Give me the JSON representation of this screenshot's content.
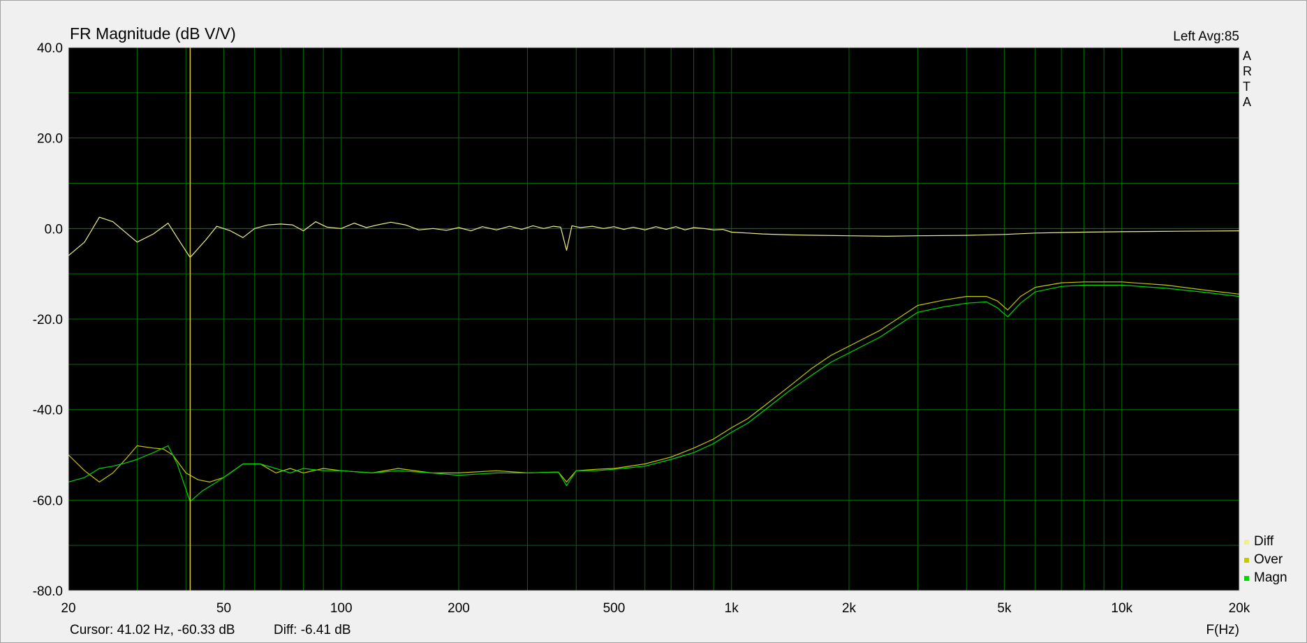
{
  "chart_data": {
    "type": "line",
    "title": "FR Magnitude (dB V/V)",
    "channel_info": "Left  Avg:85",
    "brand": [
      "A",
      "R",
      "T",
      "A"
    ],
    "xlabel": "F(Hz)",
    "xscale": "log",
    "xlim": [
      20,
      20000
    ],
    "ylim": [
      -80,
      40
    ],
    "x_ticks": [
      {
        "value": 20,
        "label": "20"
      },
      {
        "value": 50,
        "label": "50"
      },
      {
        "value": 100,
        "label": "100"
      },
      {
        "value": 200,
        "label": "200"
      },
      {
        "value": 500,
        "label": "500"
      },
      {
        "value": 1000,
        "label": "1k"
      },
      {
        "value": 2000,
        "label": "2k"
      },
      {
        "value": 5000,
        "label": "5k"
      },
      {
        "value": 10000,
        "label": "10k"
      },
      {
        "value": 20000,
        "label": "20k"
      }
    ],
    "y_ticks": [
      {
        "value": 40,
        "label": "40.0"
      },
      {
        "value": 20,
        "label": "20.0"
      },
      {
        "value": 0,
        "label": "0.0"
      },
      {
        "value": -20,
        "label": "-20.0"
      },
      {
        "value": -40,
        "label": "-40.0"
      },
      {
        "value": -60,
        "label": "-60.0"
      },
      {
        "value": -80,
        "label": "-80.0"
      }
    ],
    "grid": true,
    "legend_position": "bottom-right",
    "cursor": {
      "frequency": 41.02,
      "text": "Cursor: 41.02 Hz, -60.33 dB",
      "diff_text": "Diff: -6.41 dB",
      "color": "#d8c832"
    },
    "colors": {
      "background": "#000000",
      "frame": "#d0d0d0",
      "grid": "#006a00",
      "grid_zero": "#008a00"
    },
    "series": [
      {
        "name": "Diff",
        "color": "#f0f090",
        "points": [
          [
            20,
            -6
          ],
          [
            22,
            -3
          ],
          [
            24,
            2.5
          ],
          [
            26,
            1.5
          ],
          [
            30,
            -3
          ],
          [
            33,
            -1.2
          ],
          [
            36,
            1.2
          ],
          [
            38,
            -2
          ],
          [
            41,
            -6.4
          ],
          [
            45,
            -2.5
          ],
          [
            48,
            0.5
          ],
          [
            52,
            -0.5
          ],
          [
            56,
            -2
          ],
          [
            60,
            0
          ],
          [
            65,
            0.8
          ],
          [
            70,
            1
          ],
          [
            75,
            0.8
          ],
          [
            80,
            -0.5
          ],
          [
            86,
            1.5
          ],
          [
            92,
            0.3
          ],
          [
            100,
            0
          ],
          [
            108,
            1.2
          ],
          [
            116,
            0.2
          ],
          [
            124,
            0.8
          ],
          [
            134,
            1.4
          ],
          [
            146,
            0.8
          ],
          [
            158,
            -0.3
          ],
          [
            172,
            0
          ],
          [
            186,
            -0.4
          ],
          [
            200,
            0.2
          ],
          [
            215,
            -0.5
          ],
          [
            230,
            0.4
          ],
          [
            250,
            -0.3
          ],
          [
            270,
            0.5
          ],
          [
            290,
            -0.2
          ],
          [
            310,
            0.6
          ],
          [
            330,
            0
          ],
          [
            350,
            0.5
          ],
          [
            365,
            0.3
          ],
          [
            378,
            -4.8
          ],
          [
            390,
            0.6
          ],
          [
            410,
            0.2
          ],
          [
            440,
            0.5
          ],
          [
            470,
            0
          ],
          [
            500,
            0.4
          ],
          [
            530,
            -0.2
          ],
          [
            560,
            0.3
          ],
          [
            600,
            -0.3
          ],
          [
            640,
            0.4
          ],
          [
            680,
            -0.2
          ],
          [
            720,
            0.4
          ],
          [
            760,
            -0.3
          ],
          [
            800,
            0.2
          ],
          [
            850,
            0
          ],
          [
            900,
            -0.3
          ],
          [
            950,
            -0.2
          ],
          [
            1000,
            -0.8
          ],
          [
            1100,
            -1
          ],
          [
            1200,
            -1.2
          ],
          [
            1400,
            -1.4
          ],
          [
            1700,
            -1.5
          ],
          [
            2000,
            -1.6
          ],
          [
            2500,
            -1.7
          ],
          [
            3000,
            -1.6
          ],
          [
            4000,
            -1.5
          ],
          [
            5000,
            -1.3
          ],
          [
            6000,
            -1
          ],
          [
            8000,
            -0.8
          ],
          [
            10000,
            -0.7
          ],
          [
            14000,
            -0.6
          ],
          [
            20000,
            -0.5
          ]
        ]
      },
      {
        "name": "Over",
        "color": "#c8c800",
        "points": [
          [
            20,
            -50
          ],
          [
            22,
            -53.5
          ],
          [
            24,
            -56
          ],
          [
            26,
            -54
          ],
          [
            28,
            -51
          ],
          [
            30,
            -48
          ],
          [
            33,
            -48.5
          ],
          [
            35,
            -48.7
          ],
          [
            37,
            -50
          ],
          [
            40,
            -54
          ],
          [
            43,
            -55.5
          ],
          [
            46,
            -56
          ],
          [
            50,
            -55
          ],
          [
            56,
            -52
          ],
          [
            62,
            -52
          ],
          [
            68,
            -54
          ],
          [
            74,
            -53
          ],
          [
            80,
            -54
          ],
          [
            90,
            -53
          ],
          [
            100,
            -53.5
          ],
          [
            120,
            -54
          ],
          [
            140,
            -53
          ],
          [
            170,
            -54
          ],
          [
            200,
            -54
          ],
          [
            250,
            -53.5
          ],
          [
            300,
            -54
          ],
          [
            360,
            -53.8
          ],
          [
            378,
            -56
          ],
          [
            400,
            -53.5
          ],
          [
            450,
            -53.2
          ],
          [
            500,
            -53
          ],
          [
            600,
            -52
          ],
          [
            700,
            -50.5
          ],
          [
            800,
            -48.5
          ],
          [
            900,
            -46.5
          ],
          [
            1000,
            -44
          ],
          [
            1100,
            -42
          ],
          [
            1200,
            -39.5
          ],
          [
            1400,
            -35
          ],
          [
            1600,
            -31
          ],
          [
            1800,
            -28
          ],
          [
            2000,
            -26
          ],
          [
            2400,
            -22.5
          ],
          [
            3000,
            -17
          ],
          [
            3500,
            -15.8
          ],
          [
            4000,
            -15
          ],
          [
            4500,
            -15
          ],
          [
            4800,
            -16
          ],
          [
            5100,
            -18
          ],
          [
            5500,
            -15
          ],
          [
            6000,
            -13
          ],
          [
            7000,
            -12
          ],
          [
            8000,
            -11.8
          ],
          [
            10000,
            -11.8
          ],
          [
            13000,
            -12.5
          ],
          [
            16000,
            -13.5
          ],
          [
            20000,
            -14.5
          ]
        ]
      },
      {
        "name": "Magn",
        "color": "#00d800",
        "points": [
          [
            20,
            -56
          ],
          [
            22,
            -55
          ],
          [
            24,
            -53
          ],
          [
            26,
            -52.5
          ],
          [
            28,
            -51.8
          ],
          [
            30,
            -51
          ],
          [
            33,
            -49.5
          ],
          [
            36,
            -48
          ],
          [
            38,
            -52
          ],
          [
            41,
            -60.3
          ],
          [
            44,
            -58
          ],
          [
            48,
            -56
          ],
          [
            52,
            -54
          ],
          [
            56,
            -52
          ],
          [
            62,
            -52
          ],
          [
            68,
            -53
          ],
          [
            74,
            -54
          ],
          [
            80,
            -53
          ],
          [
            90,
            -53.5
          ],
          [
            100,
            -53.5
          ],
          [
            120,
            -54
          ],
          [
            140,
            -53.5
          ],
          [
            170,
            -54
          ],
          [
            200,
            -54.5
          ],
          [
            250,
            -54
          ],
          [
            300,
            -54
          ],
          [
            360,
            -53.8
          ],
          [
            378,
            -56.8
          ],
          [
            400,
            -53.5
          ],
          [
            450,
            -53.5
          ],
          [
            500,
            -53.2
          ],
          [
            600,
            -52.5
          ],
          [
            700,
            -51
          ],
          [
            800,
            -49.5
          ],
          [
            900,
            -47.5
          ],
          [
            1000,
            -45
          ],
          [
            1100,
            -43
          ],
          [
            1200,
            -40.5
          ],
          [
            1400,
            -36
          ],
          [
            1600,
            -32.5
          ],
          [
            1800,
            -29.5
          ],
          [
            2000,
            -27.5
          ],
          [
            2400,
            -24
          ],
          [
            3000,
            -18.5
          ],
          [
            3500,
            -17.3
          ],
          [
            4000,
            -16.5
          ],
          [
            4500,
            -16.2
          ],
          [
            4800,
            -17.5
          ],
          [
            5100,
            -19.5
          ],
          [
            5500,
            -16.5
          ],
          [
            6000,
            -14
          ],
          [
            7000,
            -12.8
          ],
          [
            8000,
            -12.5
          ],
          [
            10000,
            -12.5
          ],
          [
            13000,
            -13.2
          ],
          [
            16000,
            -14
          ],
          [
            20000,
            -15
          ]
        ]
      }
    ]
  }
}
